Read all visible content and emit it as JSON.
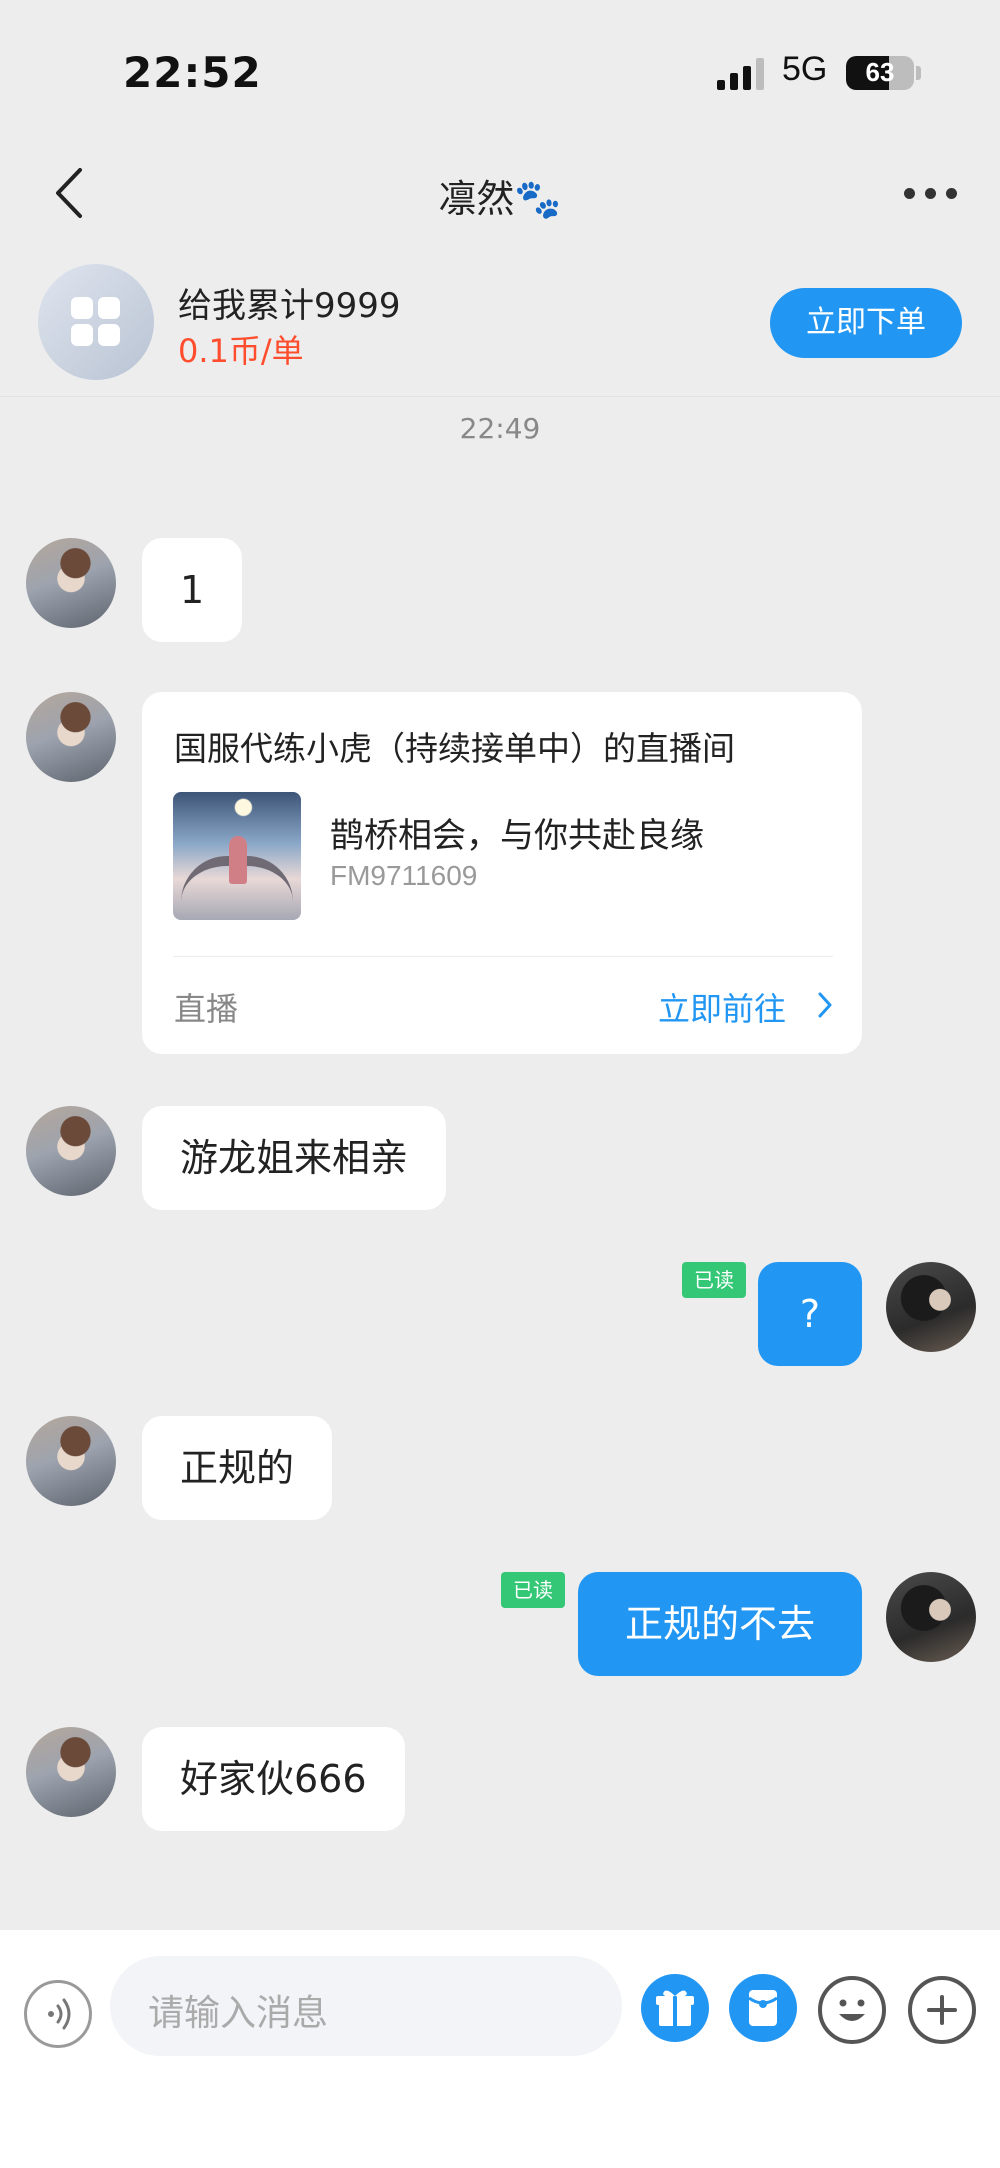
{
  "status_bar": {
    "time": "22:52",
    "network": "5G",
    "battery": "63",
    "battery_level": 0.63
  },
  "header": {
    "title": "凛然🐾"
  },
  "order": {
    "title": "给我累计9999",
    "price": "0.1币/单",
    "button": "立即下单"
  },
  "timestamp": "22:49",
  "messages": {
    "m1": "1",
    "live": {
      "title": "国服代练小虎（持续接单中）的直播间",
      "room_name": "鹊桥相会，与你共赴良缘",
      "room_id": "FM9711609",
      "tag": "直播",
      "go": "立即前往"
    },
    "m3": "游龙姐来相亲",
    "m4": "?",
    "m4_read": "已读",
    "m5": "正规的",
    "m6": "正规的不去",
    "m6_read": "已读",
    "m7": "好家伙666"
  },
  "input": {
    "placeholder": "请输入消息"
  },
  "icons": {
    "back": "chevron-left-icon",
    "more": "more-dots-icon",
    "order": "apps-grid-icon",
    "voice": "voice-icon",
    "gift": "gift-icon",
    "red_packet": "red-packet-icon",
    "emoji": "emoji-icon",
    "plus": "plus-icon"
  },
  "colors": {
    "accent": "#2196f3",
    "price": "#ff4d2d",
    "read_badge": "#33c776",
    "background": "#ededed"
  }
}
